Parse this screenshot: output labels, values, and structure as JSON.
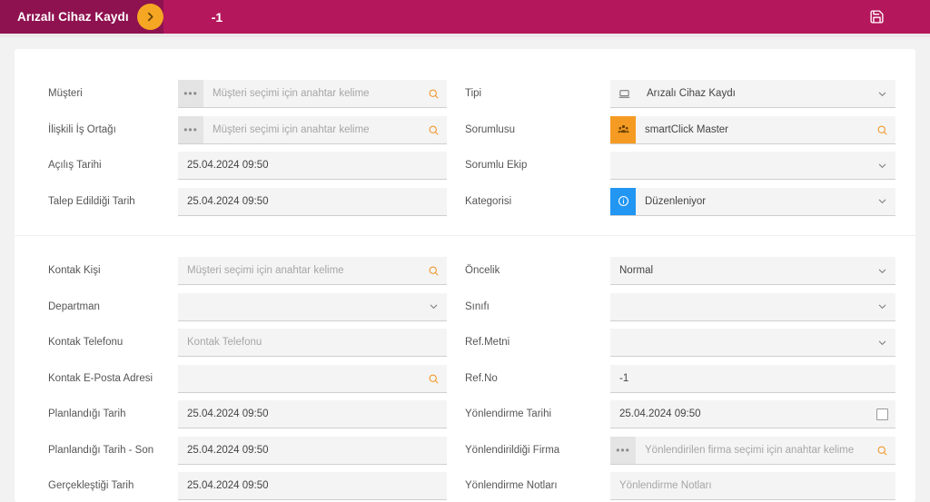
{
  "header": {
    "title": "Arızalı Cihaz Kaydı",
    "expand_icon": "chevron-right-icon",
    "record_id": "-1",
    "save_icon": "save-floppy-icon",
    "bar_color": "#b5175c",
    "tab_color": "#8e1250",
    "accent_color": "#f5a623"
  },
  "form": {
    "sections": [
      {
        "left": [
          {
            "label": "Müşteri",
            "type": "lookup",
            "prefix": "ellipsis-button",
            "value": "",
            "placeholder": "Müşteri seçimi için anahtar kelime",
            "trailing": "search-icon"
          },
          {
            "label": "İlişkili İş Ortağı",
            "type": "lookup",
            "prefix": "ellipsis-button",
            "value": "",
            "placeholder": "Müşteri seçimi için anahtar kelime",
            "trailing": "search-icon"
          },
          {
            "label": "Açılış Tarihi",
            "type": "text",
            "value": "25.04.2024 09:50",
            "placeholder": "",
            "trailing": ""
          },
          {
            "label": "Talep Edildiği Tarih",
            "type": "text",
            "value": "25.04.2024 09:50",
            "placeholder": "",
            "trailing": ""
          }
        ],
        "right": [
          {
            "label": "Tipi",
            "type": "select",
            "prefix": "monitor-icon",
            "value": "Arızalı Cihaz Kaydı",
            "placeholder": "",
            "trailing": "chevron-down-icon"
          },
          {
            "label": "Sorumlusu",
            "type": "lookup",
            "prefix": "users-group-icon",
            "prefix_color": "#f59b23",
            "value": "smartClick Master",
            "placeholder": "",
            "trailing": "search-icon"
          },
          {
            "label": "Sorumlu Ekip",
            "type": "select",
            "value": "",
            "placeholder": "",
            "trailing": "chevron-down-icon"
          },
          {
            "label": "Kategorisi",
            "type": "select",
            "prefix": "info-circle-icon",
            "prefix_color": "#2196f3",
            "value": "Düzenleniyor",
            "placeholder": "",
            "trailing": "chevron-down-icon"
          }
        ]
      },
      {
        "left": [
          {
            "label": "Kontak Kişi",
            "type": "lookup",
            "value": "",
            "placeholder": "Müşteri seçimi için anahtar kelime",
            "trailing": "search-icon"
          },
          {
            "label": "Departman",
            "type": "select",
            "value": "",
            "placeholder": "",
            "trailing": "chevron-down-icon"
          },
          {
            "label": "Kontak Telefonu",
            "type": "text",
            "value": "",
            "placeholder": "Kontak Telefonu",
            "trailing": ""
          },
          {
            "label": "Kontak E-Posta Adresi",
            "type": "lookup",
            "value": "",
            "placeholder": "",
            "trailing": "search-icon"
          },
          {
            "label": "Planlandığı Tarih",
            "type": "text",
            "value": "25.04.2024 09:50",
            "placeholder": "",
            "trailing": ""
          },
          {
            "label": "Planlandığı Tarih - Son",
            "type": "text",
            "value": "25.04.2024 09:50",
            "placeholder": "",
            "trailing": ""
          },
          {
            "label": "Gerçekleştiği Tarih",
            "type": "text",
            "value": "25.04.2024 09:50",
            "placeholder": "",
            "trailing": ""
          }
        ],
        "right": [
          {
            "label": "Öncelik",
            "type": "select",
            "value": "Normal",
            "placeholder": "",
            "trailing": "chevron-down-icon"
          },
          {
            "label": "Sınıfı",
            "type": "select",
            "value": "",
            "placeholder": "",
            "trailing": "chevron-down-icon"
          },
          {
            "label": "Ref.Metni",
            "type": "select",
            "value": "",
            "placeholder": "",
            "trailing": "chevron-down-icon"
          },
          {
            "label": "Ref.No",
            "type": "text",
            "value": "-1",
            "placeholder": "",
            "trailing": ""
          },
          {
            "label": "Yönlendirme Tarihi",
            "type": "text",
            "value": "25.04.2024 09:50",
            "placeholder": "",
            "trailing": "checkbox-unchecked"
          },
          {
            "label": "Yönlendirildiği Firma",
            "type": "lookup",
            "prefix": "ellipsis-button",
            "value": "",
            "placeholder": "Yönlendirilen firma seçimi için anahtar kelime",
            "trailing": "search-icon"
          },
          {
            "label": "Yönlendirme Notları",
            "type": "text",
            "value": "",
            "placeholder": "Yönlendirme Notları",
            "trailing": ""
          }
        ]
      }
    ]
  }
}
